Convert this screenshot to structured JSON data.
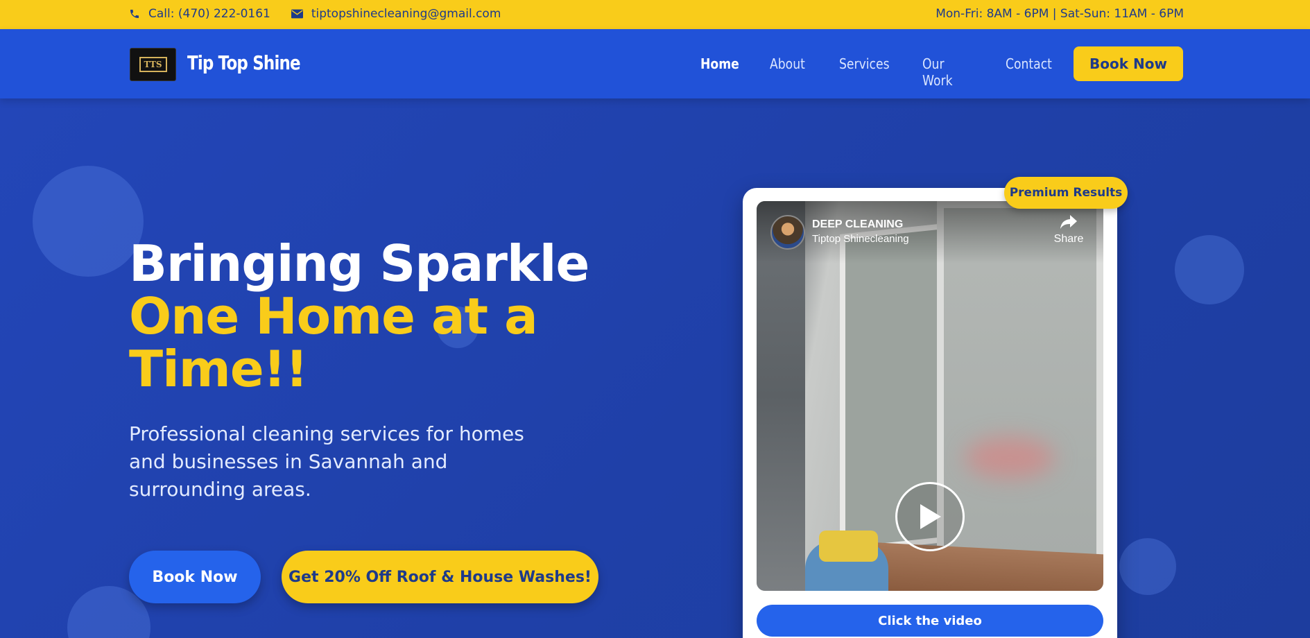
{
  "topbar": {
    "phone": "Call: (470) 222-0161",
    "email": "tiptopshinecleaning@gmail.com",
    "hours": "Mon-Fri: 8AM - 6PM | Sat-Sun: 11AM - 6PM",
    "phone_icon": "phone-icon",
    "email_icon": "envelope-icon"
  },
  "nav": {
    "logo_text": "TTS",
    "brand": "Tip Top Shine",
    "links": [
      "Home",
      "About",
      "Services",
      "Our Work",
      "Contact"
    ],
    "active_link": "Home",
    "book_label": "Book Now"
  },
  "hero": {
    "title_line1": "Bringing Sparkle",
    "title_highlight": "One Home at a Time!!",
    "subtitle": "Professional cleaning services for homes and businesses in Savannah and surrounding areas.",
    "book_button": "Book Now",
    "offer_button": "Get 20% Off Roof & House Washes!"
  },
  "video_card": {
    "badge": "Premium Results",
    "video_title": "DEEP CLEANING",
    "channel": "Tiptop Shinecleaning",
    "share_label": "Share",
    "cta": "Click the video"
  },
  "colors": {
    "accent_yellow": "#f9cc1a",
    "nav_blue": "#2152d8",
    "hero_blue": "#1f40a8",
    "button_blue": "#2563eb",
    "text_navy": "#1e3a8a"
  }
}
